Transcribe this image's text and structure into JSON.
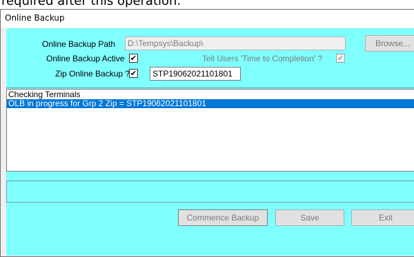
{
  "top_fragment": "required after this operation.",
  "window": {
    "title": "Online Backup"
  },
  "path": {
    "label": "Online Backup Path",
    "value": "D:\\Tempsys\\Backup\\",
    "browse_label": "Browse..."
  },
  "active": {
    "label": "Online Backup Active",
    "checked": "✔"
  },
  "tell_users": {
    "label": "Tell Users 'Time to Completion' ?",
    "checked": "✔"
  },
  "zip": {
    "label": "Zip Online Backup ?",
    "checked": "✔",
    "filename": "STP19062021101801"
  },
  "log": {
    "lines": [
      "Checking Terminals",
      "OLB in progress for Grp 2 Zip = STP19062021101801"
    ],
    "selected_index": 1
  },
  "buttons": {
    "commence": "Commence Backup",
    "save": "Save",
    "exit": "Exit"
  },
  "colors": {
    "client_bg": "#80ffff",
    "selection": "#0078d7"
  }
}
